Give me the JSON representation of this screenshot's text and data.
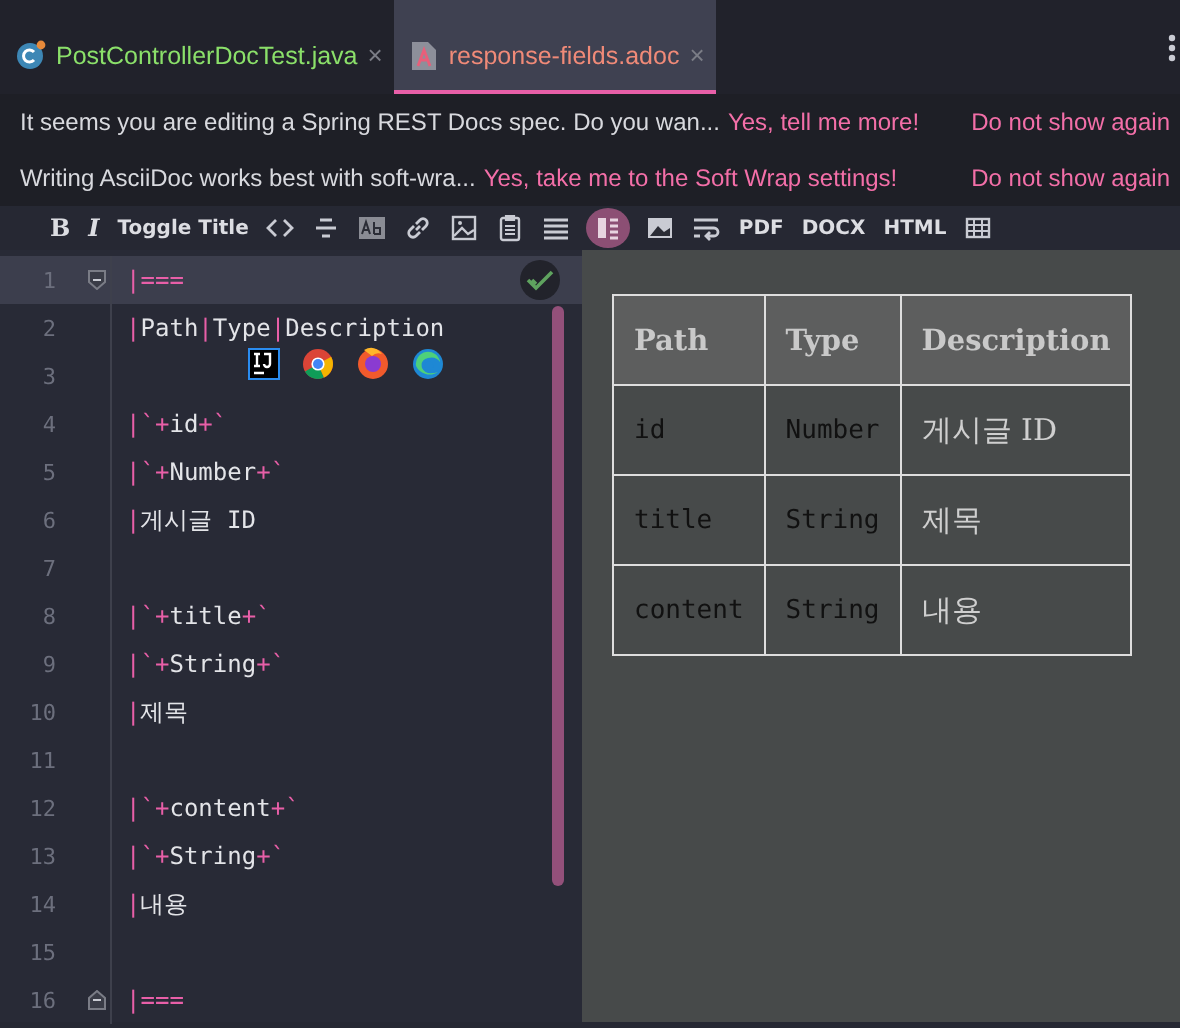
{
  "tabs": [
    {
      "label": "PostControllerDocTest.java",
      "kind": "java",
      "selected": false,
      "close": "×"
    },
    {
      "label": "response-fields.adoc",
      "kind": "adoc",
      "selected": true,
      "close": "×"
    }
  ],
  "notifications": [
    {
      "message": "It seems you are editing a Spring REST Docs spec. Do you wan...",
      "actions": [
        "Yes, tell me more!",
        "Do not show again"
      ]
    },
    {
      "message": "Writing AsciiDoc works best with soft-wra...",
      "actions": [
        "Yes, take me to the Soft Wrap settings!",
        "Do not show again"
      ]
    }
  ],
  "toolbar": [
    {
      "kind": "text",
      "label": "B",
      "selected": false
    },
    {
      "kind": "text",
      "label": "I",
      "selected": false
    },
    {
      "kind": "text",
      "label": "Toggle Title",
      "selected": false
    },
    {
      "kind": "icon",
      "selected": false
    },
    {
      "kind": "icon",
      "selected": false
    },
    {
      "kind": "icon",
      "selected": false
    },
    {
      "kind": "icon",
      "selected": false
    },
    {
      "kind": "icon",
      "selected": false
    },
    {
      "kind": "icon",
      "selected": false
    },
    {
      "kind": "icon",
      "selected": false
    },
    {
      "kind": "icon",
      "selected": true
    },
    {
      "kind": "icon",
      "selected": false
    },
    {
      "kind": "icon",
      "selected": false
    },
    {
      "kind": "text",
      "label": "PDF",
      "selected": false
    },
    {
      "kind": "text",
      "label": "DOCX",
      "selected": false
    },
    {
      "kind": "text",
      "label": "HTML",
      "selected": false
    },
    {
      "kind": "icon",
      "selected": false
    }
  ],
  "editor": {
    "lines": [
      {
        "number": "1",
        "text": "|===",
        "current": true
      },
      {
        "number": "2",
        "text": "|Path|Type|Description",
        "current": false
      },
      {
        "number": "3",
        "current": false
      },
      {
        "number": "4",
        "text": "|`+id+`",
        "current": false
      },
      {
        "number": "5",
        "text": "|`+Number+`",
        "current": false
      },
      {
        "number": "6",
        "text": "|게시글 ID",
        "current": false
      },
      {
        "number": "7",
        "current": false
      },
      {
        "number": "8",
        "text": "|`+title+`",
        "current": false
      },
      {
        "number": "9",
        "text": "|`+String+`",
        "current": false
      },
      {
        "number": "10",
        "text": "|제목",
        "current": false
      },
      {
        "number": "11",
        "current": false
      },
      {
        "number": "12",
        "text": "|`+content+`",
        "current": false
      },
      {
        "number": "13",
        "text": "|`+String+`",
        "current": false
      },
      {
        "number": "14",
        "text": "|내용",
        "current": false
      },
      {
        "number": "15",
        "current": false
      },
      {
        "number": "16",
        "text": "|===",
        "current": false
      }
    ]
  },
  "preview": {
    "table": {
      "columns": [
        "Path",
        "Type",
        "Description"
      ],
      "rows": [
        [
          "id",
          "Number",
          "게시글 ID"
        ],
        [
          "title",
          "String",
          "제목"
        ],
        [
          "content",
          "String",
          "내용"
        ]
      ]
    }
  }
}
